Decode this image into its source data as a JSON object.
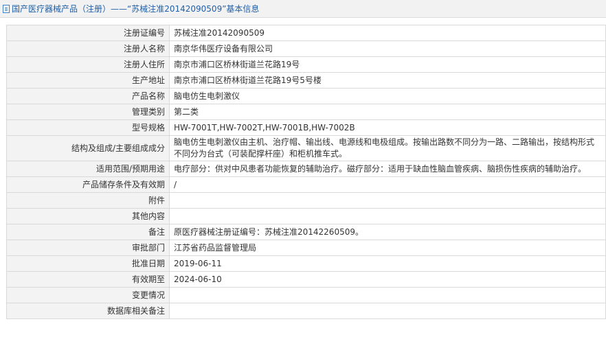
{
  "header": {
    "title": "国产医疗器械产品（注册）——“苏械注准20142090509”基本信息"
  },
  "rows": [
    {
      "label": "注册证编号",
      "value": "苏械注准20142090509"
    },
    {
      "label": "注册人名称",
      "value": "南京华伟医疗设备有限公司"
    },
    {
      "label": "注册人住所",
      "value": "南京市浦口区桥林街道兰花路19号"
    },
    {
      "label": "生产地址",
      "value": "南京市浦口区桥林街道兰花路19号5号楼"
    },
    {
      "label": "产品名称",
      "value": "脑电仿生电刺激仪"
    },
    {
      "label": "管理类别",
      "value": "第二类"
    },
    {
      "label": "型号规格",
      "value": "HW-7001T,HW-7002T,HW-7001B,HW-7002B"
    },
    {
      "label": "结构及组成/主要组成成分",
      "value": "脑电仿生电刺激仪由主机、治疗帽、输出线、电源线和电极组成。按输出路数不同分为一路、二路输出，按结构形式不同分为台式（可装配撑杆座）和柜机推车式。"
    },
    {
      "label": "适用范围/预期用途",
      "value": "电疗部分：供对中风患者功能恢复的辅助治疗。磁疗部分：适用于缺血性脑血管疾病、脑损伤性疾病的辅助治疗。"
    },
    {
      "label": "产品储存条件及有效期",
      "value": "/"
    },
    {
      "label": "附件",
      "value": ""
    },
    {
      "label": "其他内容",
      "value": ""
    },
    {
      "label": "备注",
      "value": "原医疗器械注册证编号：苏械注准20142260509。"
    },
    {
      "label": "审批部门",
      "value": "江苏省药品监督管理局"
    },
    {
      "label": "批准日期",
      "value": "2019-06-11"
    },
    {
      "label": "有效期至",
      "value": "2024-06-10"
    },
    {
      "label": "变更情况",
      "value": ""
    },
    {
      "label": "数据库相关备注",
      "value": ""
    }
  ]
}
